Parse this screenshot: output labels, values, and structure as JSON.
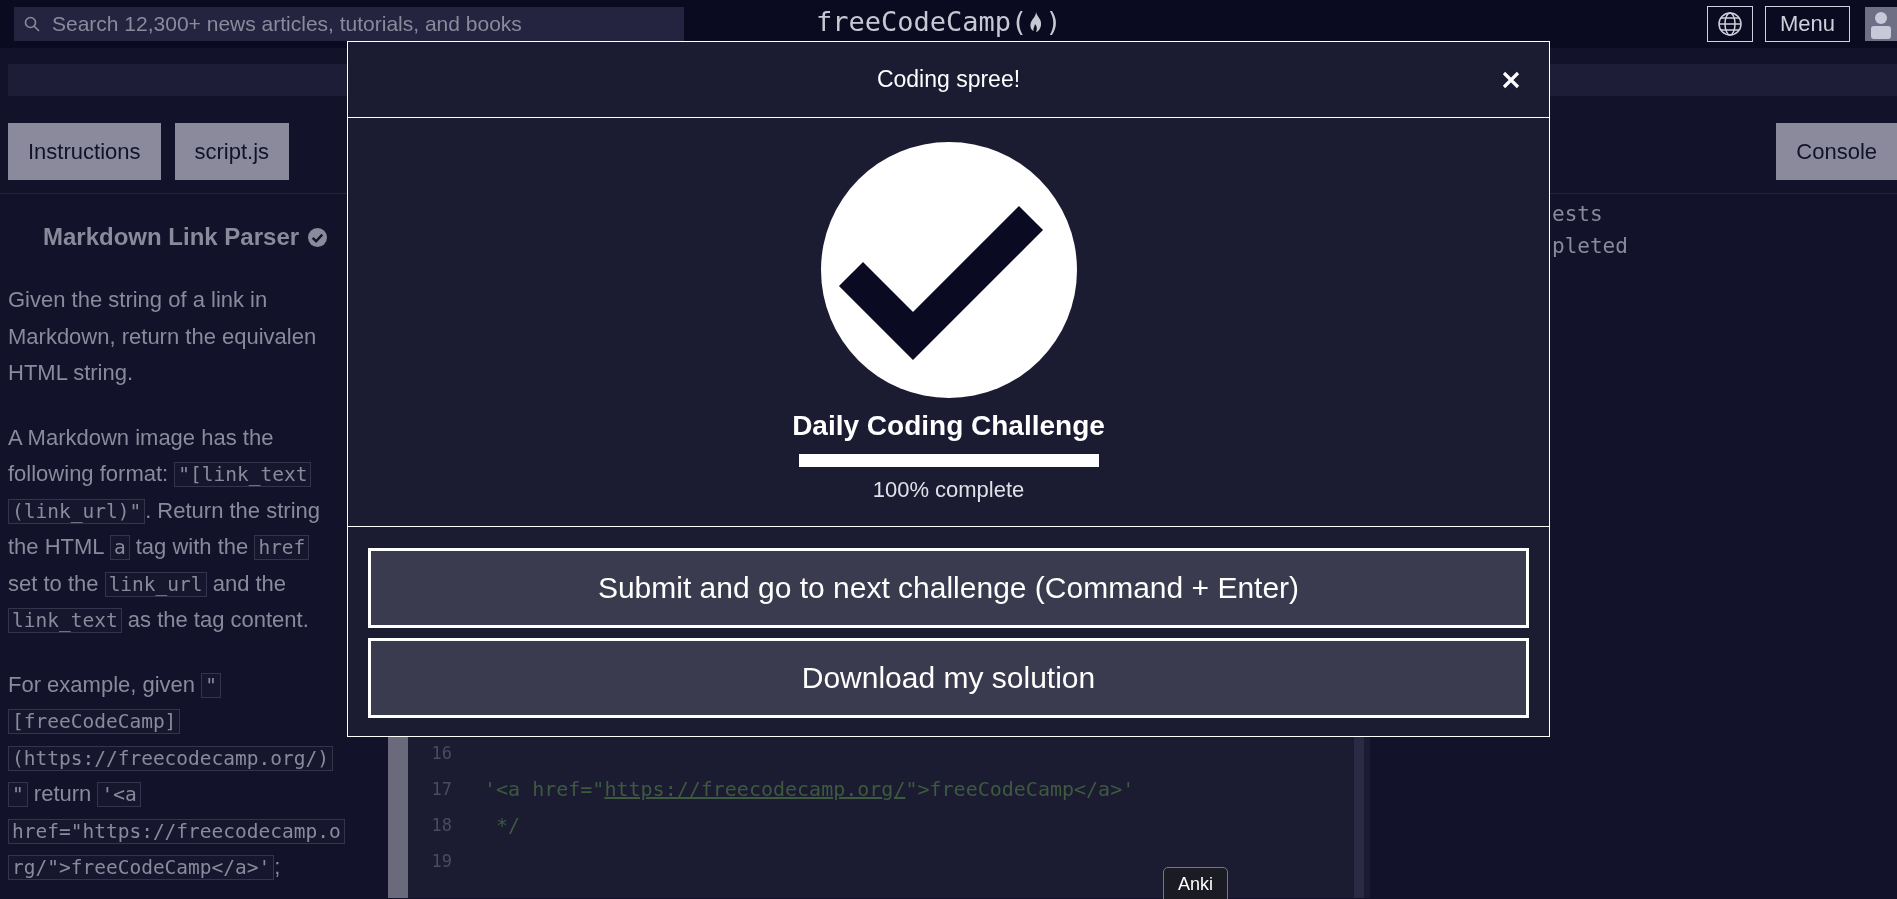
{
  "nav": {
    "search_placeholder": "Search 12,300+ news articles, tutorials, and books",
    "logo_start": "freeCodeCamp(",
    "logo_end": ")",
    "menu_button": "Menu"
  },
  "tabs": [
    {
      "label": "Instructions",
      "selected": false
    },
    {
      "label": "script.js",
      "selected": false
    },
    {
      "label": "Console",
      "selected": false
    }
  ],
  "challenge": {
    "title": "Markdown Link Parser",
    "completed": true,
    "paragraphs": [
      [
        [
          {
            "kind": "text",
            "text": "Given the string of a link in"
          }
        ],
        [
          {
            "kind": "text",
            "text": "Markdown, return the equivalen"
          }
        ],
        [
          {
            "kind": "text",
            "text": "HTML string."
          }
        ]
      ],
      [
        [
          {
            "kind": "text",
            "text": "A Markdown image has the"
          }
        ],
        [
          {
            "kind": "text",
            "text": "following format: "
          },
          {
            "kind": "code",
            "text": "\"[link_text"
          }
        ],
        [
          {
            "kind": "code",
            "text": "(link_url)\""
          },
          {
            "kind": "text",
            "text": ". Return the string"
          }
        ],
        [
          {
            "kind": "text",
            "text": "the HTML "
          },
          {
            "kind": "code",
            "text": "a"
          },
          {
            "kind": "text",
            "text": " tag with the "
          },
          {
            "kind": "code",
            "text": "href"
          }
        ],
        [
          {
            "kind": "text",
            "text": "set to the "
          },
          {
            "kind": "code",
            "text": "link_url"
          },
          {
            "kind": "text",
            "text": " and the"
          }
        ],
        [
          {
            "kind": "code",
            "text": "link_text"
          },
          {
            "kind": "text",
            "text": " as the tag content."
          }
        ]
      ],
      [
        [
          {
            "kind": "text",
            "text": "For example, given "
          },
          {
            "kind": "code",
            "text": "\""
          }
        ],
        [
          {
            "kind": "code",
            "text": "[freeCodeCamp]"
          }
        ],
        [
          {
            "kind": "code",
            "text": "(https://freecodecamp.org/)"
          }
        ],
        [
          {
            "kind": "code",
            "text": "\""
          },
          {
            "kind": "text",
            "text": " return "
          },
          {
            "kind": "code",
            "text": "'<a "
          }
        ],
        [
          {
            "kind": "code",
            "text": "href=\"https://freecodecamp.o"
          }
        ],
        [
          {
            "kind": "code",
            "text": "rg/\">freeCodeCamp</a>'"
          },
          {
            "kind": "text",
            "text": ";"
          }
        ]
      ]
    ]
  },
  "editor": {
    "lines": [
      {
        "number": "16"
      },
      {
        "number": "17",
        "segments": [
          {
            "kind": "plain",
            "text": "'<a href=\""
          },
          {
            "kind": "link",
            "text": "https://freecodecamp.org/"
          },
          {
            "kind": "plain",
            "text": "\">freeCodeCamp</a>'"
          }
        ]
      },
      {
        "number": "18",
        "segments": [
          {
            "kind": "plain",
            "text": " */"
          }
        ]
      },
      {
        "number": "19"
      }
    ]
  },
  "console": {
    "lines": [
      "ests",
      "pleted"
    ]
  },
  "modal": {
    "title": "Coding spree!",
    "heading": "Daily Coding Challenge",
    "progress": {
      "level": 1
    },
    "progress_label": "100% complete",
    "buttons": [
      "Submit and go to next challenge (Command + Enter)",
      "Download my solution"
    ]
  },
  "tooltip": {
    "text": "Anki"
  }
}
